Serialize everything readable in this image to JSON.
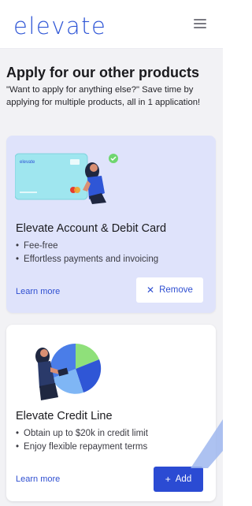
{
  "header": {
    "logo": "elevate",
    "menu_icon": "hamburger-menu-icon"
  },
  "section": {
    "title": "Apply for our other products",
    "description": "\"Want to apply for anything else?\" Save time by applying for multiple products, all in 1 application!"
  },
  "products": [
    {
      "title": "Elevate Account & Debit Card",
      "bullets": [
        "Fee-free",
        "Effortless payments and invoicing"
      ],
      "learn_more": "Learn more",
      "action_label": "Remove",
      "action_icon": "close-icon",
      "card_label": "elevate",
      "illustration": "debit-card-illustration"
    },
    {
      "title": "Elevate Credit Line",
      "bullets": [
        "Obtain up to $20k in credit limit",
        "Enjoy flexible repayment terms"
      ],
      "learn_more": "Learn more",
      "action_label": "Add",
      "action_icon": "plus-icon",
      "illustration": "pie-chart-illustration"
    }
  ],
  "colors": {
    "brand": "#2f56d6",
    "primary_button": "#2b4bd3",
    "selected_card": "#dfe3fb"
  }
}
